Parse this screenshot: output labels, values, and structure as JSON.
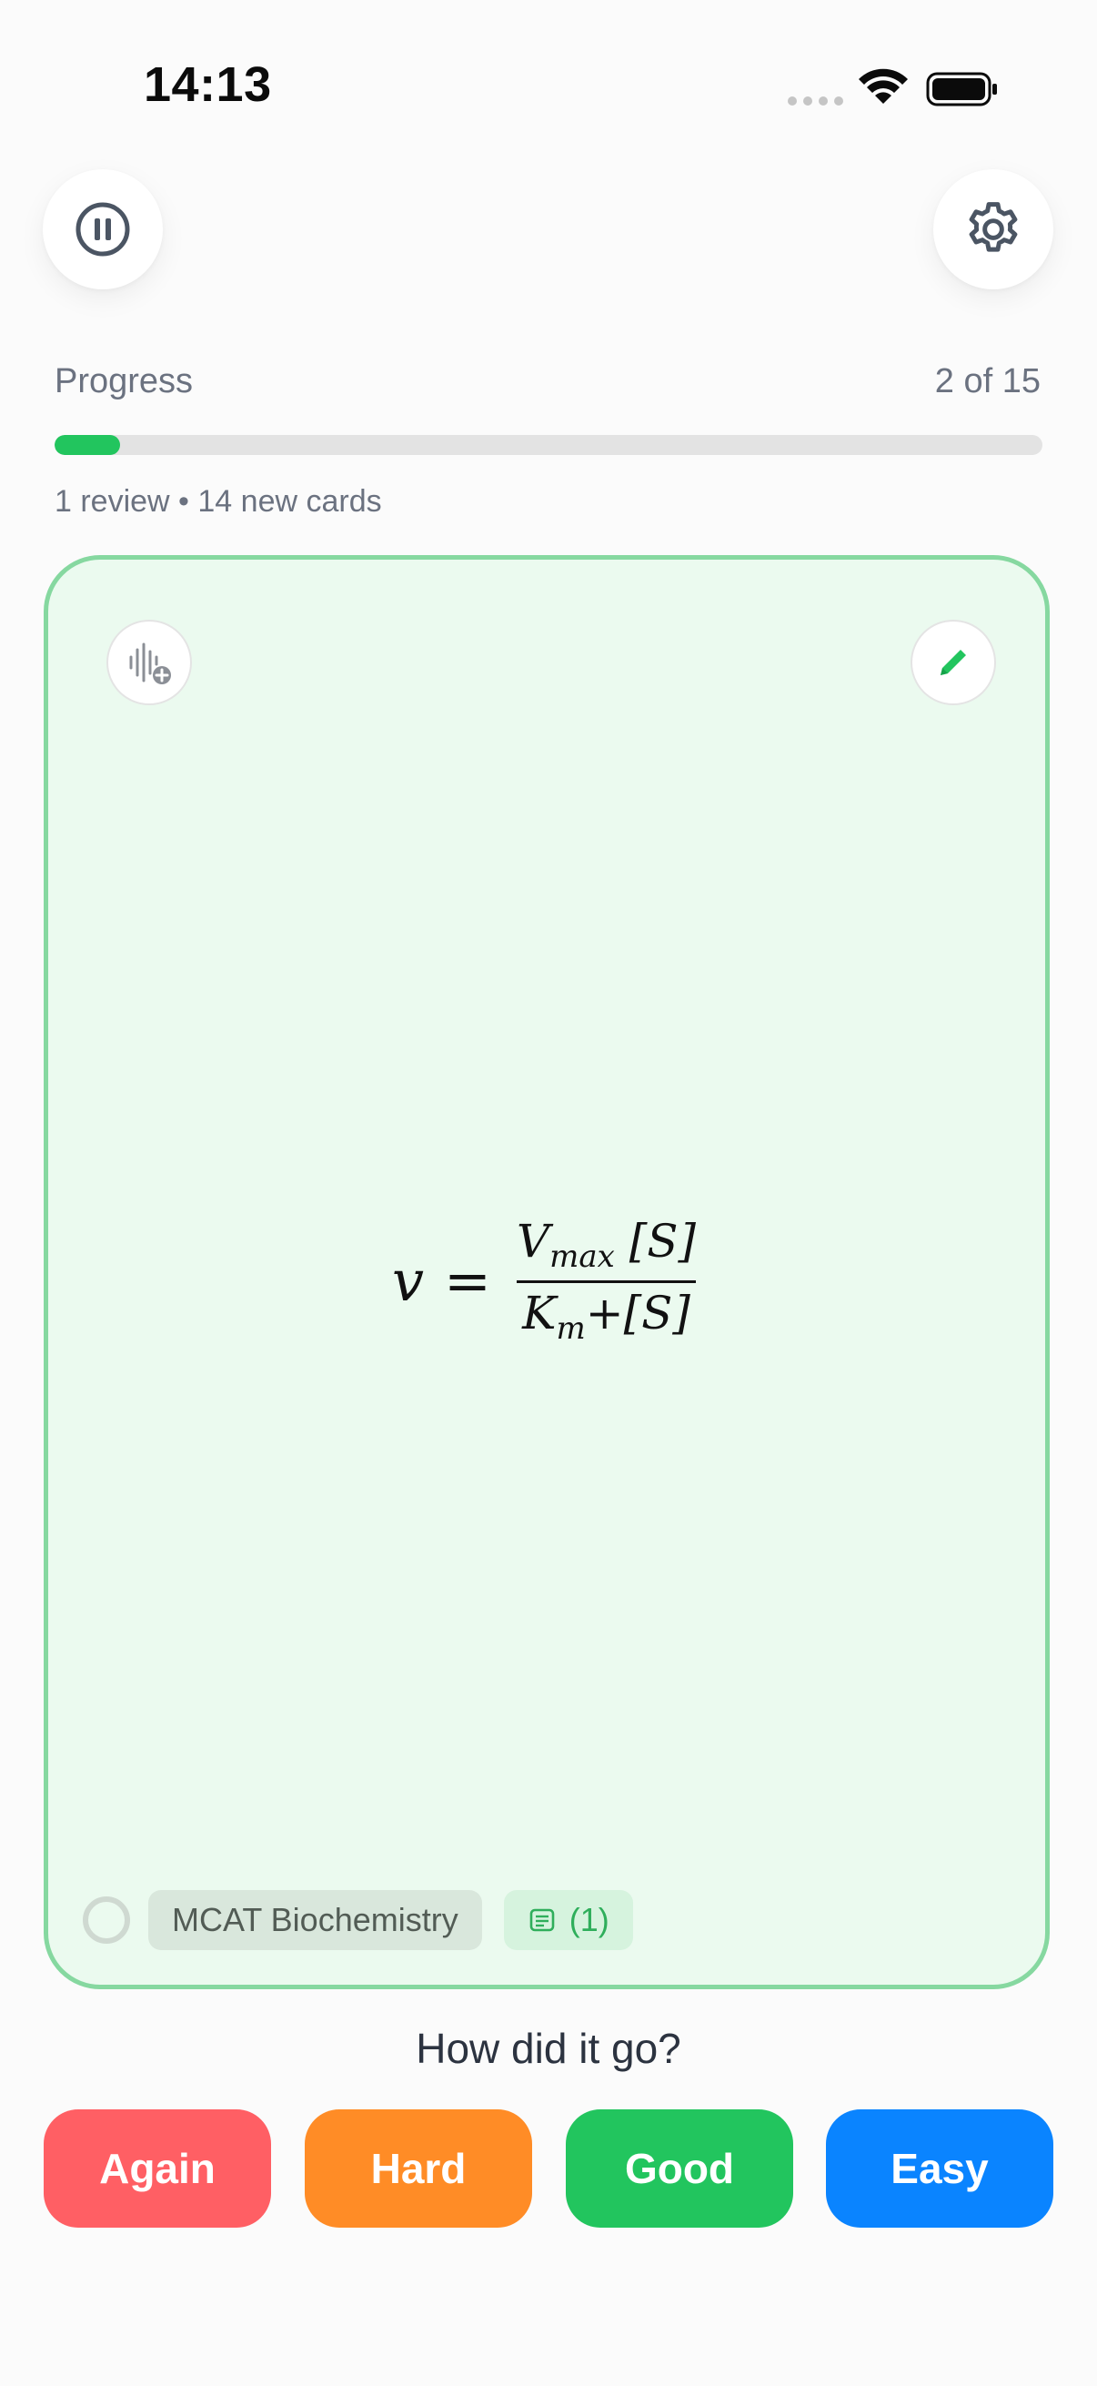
{
  "status_bar": {
    "time": "14:13"
  },
  "header": {
    "pause_icon": "pause-icon",
    "settings_icon": "gear-icon"
  },
  "progress": {
    "label": "Progress",
    "count": "2 of 15",
    "current": 2,
    "total": 15,
    "summary": "1 review • 14 new cards",
    "fill_color": "#22c55e"
  },
  "card": {
    "formula": {
      "lhs": "v",
      "equals": "=",
      "numerator_var": "V",
      "numerator_sub": "max",
      "numerator_rest": " [S]",
      "denominator_var": "K",
      "denominator_sub": "m",
      "denominator_rest": "+[S]"
    },
    "deck": "MCAT Biochemistry",
    "notes_count": "(1)",
    "border_color": "#86d8a0",
    "background_color": "#ebfaef"
  },
  "review": {
    "question": "How did it go?",
    "buttons": [
      {
        "label": "Again",
        "color": "#ff5f64"
      },
      {
        "label": "Hard",
        "color": "#ff8c26"
      },
      {
        "label": "Good",
        "color": "#22c55e"
      },
      {
        "label": "Easy",
        "color": "#0a84ff"
      }
    ]
  }
}
